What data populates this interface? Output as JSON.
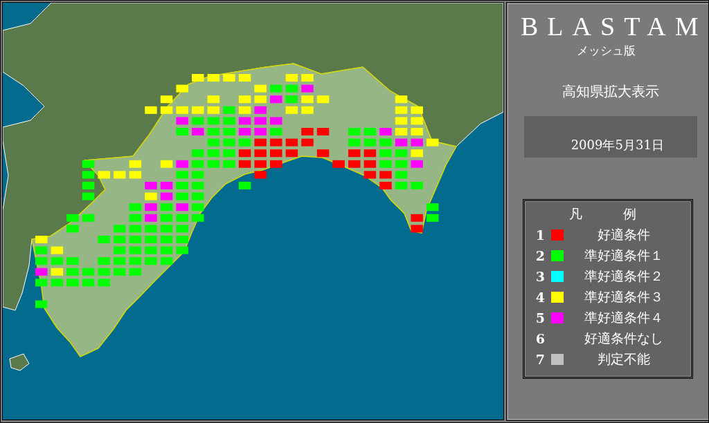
{
  "panel": {
    "title": "BLASTAM",
    "subtitle": "メッシュ版",
    "region": "高知県拡大表示",
    "date": "2009年5月31日"
  },
  "legend": {
    "title": "凡　例",
    "items": [
      {
        "number": "1",
        "color": "#ff0000",
        "label": "好適条件"
      },
      {
        "number": "2",
        "color": "#00ff00",
        "label": "準好適条件１"
      },
      {
        "number": "3",
        "color": "#00ffff",
        "label": "準好適条件２"
      },
      {
        "number": "4",
        "color": "#ffff00",
        "label": "準好適条件３"
      },
      {
        "number": "5",
        "color": "#ff00ff",
        "label": "準好適条件４"
      },
      {
        "number": "6",
        "label": "好適条件なし"
      },
      {
        "number": "7",
        "color": "#c0c0c0",
        "label": "判定不能"
      }
    ]
  },
  "mesh": [
    [
      {
        "kind": "gap"
      },
      {
        "kind": "gap"
      },
      {
        "kind": "gap"
      },
      {
        "kind": "gap"
      },
      {
        "kind": "gap"
      },
      {
        "kind": "gap"
      },
      {
        "kind": "gap"
      },
      {
        "kind": "gap"
      },
      {
        "kind": "gap"
      },
      {
        "kind": "gap"
      },
      {
        "kind": "cell",
        "color": "#ffff00"
      },
      {
        "kind": "cell",
        "color": "#ffff00"
      },
      {
        "kind": "cell",
        "color": "#ffff00"
      },
      {
        "kind": "cell",
        "color": "#ffff00"
      },
      {
        "kind": "gap"
      },
      {
        "kind": "gap"
      },
      {
        "kind": "cell",
        "color": "#ffff00"
      },
      {
        "kind": "cell",
        "color": "#ffff00"
      }
    ],
    [
      {
        "kind": "gap"
      },
      {
        "kind": "gap"
      },
      {
        "kind": "gap"
      },
      {
        "kind": "gap"
      },
      {
        "kind": "gap"
      },
      {
        "kind": "gap"
      },
      {
        "kind": "gap"
      },
      {
        "kind": "gap"
      },
      {
        "kind": "gap"
      },
      {
        "kind": "cell",
        "color": "#ffff00"
      },
      {
        "kind": "gap"
      },
      {
        "kind": "gap"
      },
      {
        "kind": "gap"
      },
      {
        "kind": "gap"
      },
      {
        "kind": "cell",
        "color": "#ffff00"
      },
      {
        "kind": "cell",
        "color": "#00ff00"
      },
      {
        "kind": "cell",
        "color": "#00ff00"
      },
      {
        "kind": "cell",
        "color": "#ff00ff"
      }
    ],
    [
      {
        "kind": "gap"
      },
      {
        "kind": "gap"
      },
      {
        "kind": "gap"
      },
      {
        "kind": "gap"
      },
      {
        "kind": "gap"
      },
      {
        "kind": "gap"
      },
      {
        "kind": "gap"
      },
      {
        "kind": "gap"
      },
      {
        "kind": "cell",
        "color": "#ffff00"
      },
      {
        "kind": "gap"
      },
      {
        "kind": "gap"
      },
      {
        "kind": "cell",
        "color": "#ffff00"
      },
      {
        "kind": "gap"
      },
      {
        "kind": "cell",
        "color": "#ffff00"
      },
      {
        "kind": "cell",
        "color": "#ffff00"
      },
      {
        "kind": "cell",
        "color": "#ff00ff"
      },
      {
        "kind": "cell",
        "color": "#00ff00"
      },
      {
        "kind": "cell",
        "color": "#ffff00"
      },
      {
        "kind": "cell",
        "color": "#ffff00"
      },
      {
        "kind": "gap"
      },
      {
        "kind": "gap"
      },
      {
        "kind": "gap"
      },
      {
        "kind": "gap"
      },
      {
        "kind": "cell",
        "color": "#ffff00"
      }
    ],
    [
      {
        "kind": "gap"
      },
      {
        "kind": "gap"
      },
      {
        "kind": "gap"
      },
      {
        "kind": "gap"
      },
      {
        "kind": "gap"
      },
      {
        "kind": "gap"
      },
      {
        "kind": "gap"
      },
      {
        "kind": "cell",
        "color": "#ffff00"
      },
      {
        "kind": "cell",
        "color": "#ffff00"
      },
      {
        "kind": "cell",
        "color": "#ffff00"
      },
      {
        "kind": "cell",
        "color": "#ffff00"
      },
      {
        "kind": "cell",
        "color": "#ffff00"
      },
      {
        "kind": "cell",
        "color": "#00ff00"
      },
      {
        "kind": "cell",
        "color": "#ffff00"
      },
      {
        "kind": "cell",
        "color": "#ff00ff"
      },
      {
        "kind": "gap"
      },
      {
        "kind": "cell",
        "color": "#ffff00"
      },
      {
        "kind": "cell",
        "color": "#ffff00"
      },
      {
        "kind": "gap"
      },
      {
        "kind": "gap"
      },
      {
        "kind": "gap"
      },
      {
        "kind": "gap"
      },
      {
        "kind": "gap"
      },
      {
        "kind": "cell",
        "color": "#ffff00"
      },
      {
        "kind": "cell",
        "color": "#ffff00"
      }
    ],
    [
      {
        "kind": "gap"
      },
      {
        "kind": "gap"
      },
      {
        "kind": "gap"
      },
      {
        "kind": "gap"
      },
      {
        "kind": "gap"
      },
      {
        "kind": "gap"
      },
      {
        "kind": "gap"
      },
      {
        "kind": "gap"
      },
      {
        "kind": "gap"
      },
      {
        "kind": "cell",
        "color": "#ff00ff"
      },
      {
        "kind": "cell",
        "color": "#00ff00"
      },
      {
        "kind": "cell",
        "color": "#00ff00"
      },
      {
        "kind": "cell",
        "color": "#00ff00"
      },
      {
        "kind": "cell",
        "color": "#ff00ff"
      },
      {
        "kind": "cell",
        "color": "#ff00ff"
      },
      {
        "kind": "cell",
        "color": "#ff00ff"
      },
      {
        "kind": "gap"
      },
      {
        "kind": "gap"
      },
      {
        "kind": "gap"
      },
      {
        "kind": "gap"
      },
      {
        "kind": "gap"
      },
      {
        "kind": "gap"
      },
      {
        "kind": "gap"
      },
      {
        "kind": "cell",
        "color": "#ffff00"
      },
      {
        "kind": "cell",
        "color": "#ffff00"
      }
    ],
    [
      {
        "kind": "gap"
      },
      {
        "kind": "gap"
      },
      {
        "kind": "gap"
      },
      {
        "kind": "gap"
      },
      {
        "kind": "gap"
      },
      {
        "kind": "gap"
      },
      {
        "kind": "gap"
      },
      {
        "kind": "gap"
      },
      {
        "kind": "gap"
      },
      {
        "kind": "cell",
        "color": "#00ff00"
      },
      {
        "kind": "cell",
        "color": "#ff00ff"
      },
      {
        "kind": "cell",
        "color": "#00ff00"
      },
      {
        "kind": "cell",
        "color": "#00ff00"
      },
      {
        "kind": "cell",
        "color": "#ff00ff"
      },
      {
        "kind": "cell",
        "color": "#ff00ff"
      },
      {
        "kind": "cell",
        "color": "#00ff00"
      },
      {
        "kind": "gap"
      },
      {
        "kind": "cell",
        "color": "#ff0000"
      },
      {
        "kind": "cell",
        "color": "#ff0000"
      },
      {
        "kind": "gap"
      },
      {
        "kind": "cell",
        "color": "#00ff00"
      },
      {
        "kind": "cell",
        "color": "#00ff00"
      },
      {
        "kind": "cell",
        "color": "#ff00ff"
      },
      {
        "kind": "cell",
        "color": "#ffff00"
      },
      {
        "kind": "cell",
        "color": "#ffff00"
      }
    ],
    [
      {
        "kind": "gap"
      },
      {
        "kind": "gap"
      },
      {
        "kind": "gap"
      },
      {
        "kind": "gap"
      },
      {
        "kind": "gap"
      },
      {
        "kind": "gap"
      },
      {
        "kind": "gap"
      },
      {
        "kind": "gap"
      },
      {
        "kind": "gap"
      },
      {
        "kind": "gap"
      },
      {
        "kind": "gap"
      },
      {
        "kind": "cell",
        "color": "#00ff00"
      },
      {
        "kind": "cell",
        "color": "#00ff00"
      },
      {
        "kind": "cell",
        "color": "#00ff00"
      },
      {
        "kind": "cell",
        "color": "#ff0000"
      },
      {
        "kind": "cell",
        "color": "#ff0000"
      },
      {
        "kind": "cell",
        "color": "#ff0000"
      },
      {
        "kind": "cell",
        "color": "#ff0000"
      },
      {
        "kind": "gap"
      },
      {
        "kind": "gap"
      },
      {
        "kind": "cell",
        "color": "#00ff00"
      },
      {
        "kind": "cell",
        "color": "#00ff00"
      },
      {
        "kind": "cell",
        "color": "#00ff00"
      },
      {
        "kind": "cell",
        "color": "#ff00ff"
      },
      {
        "kind": "cell",
        "color": "#ff00ff"
      },
      {
        "kind": "cell",
        "color": "#ffff00"
      }
    ],
    [
      {
        "kind": "gap"
      },
      {
        "kind": "gap"
      },
      {
        "kind": "gap"
      },
      {
        "kind": "gap"
      },
      {
        "kind": "gap"
      },
      {
        "kind": "gap"
      },
      {
        "kind": "gap"
      },
      {
        "kind": "gap"
      },
      {
        "kind": "gap"
      },
      {
        "kind": "gap"
      },
      {
        "kind": "cell",
        "color": "#00ff00"
      },
      {
        "kind": "cell",
        "color": "#00ff00"
      },
      {
        "kind": "cell",
        "color": "#00ff00"
      },
      {
        "kind": "cell",
        "color": "#ff0000"
      },
      {
        "kind": "cell",
        "color": "#ff0000"
      },
      {
        "kind": "cell",
        "color": "#ff0000"
      },
      {
        "kind": "cell",
        "color": "#ff0000"
      },
      {
        "kind": "gap"
      },
      {
        "kind": "cell",
        "color": "#ff0000"
      },
      {
        "kind": "gap"
      },
      {
        "kind": "cell",
        "color": "#ff0000"
      },
      {
        "kind": "cell",
        "color": "#ff0000"
      },
      {
        "kind": "cell",
        "color": "#00ff00"
      },
      {
        "kind": "cell",
        "color": "#00ff00"
      },
      {
        "kind": "cell",
        "color": "#ffff00"
      }
    ],
    [
      {
        "kind": "gap"
      },
      {
        "kind": "gap"
      },
      {
        "kind": "gap"
      },
      {
        "kind": "cell",
        "color": "#00ff00"
      },
      {
        "kind": "gap"
      },
      {
        "kind": "gap"
      },
      {
        "kind": "cell",
        "color": "#ffff00"
      },
      {
        "kind": "gap"
      },
      {
        "kind": "cell",
        "color": "#ffff00"
      },
      {
        "kind": "cell",
        "color": "#ff00ff"
      },
      {
        "kind": "cell",
        "color": "#00ff00"
      },
      {
        "kind": "cell",
        "color": "#00ff00"
      },
      {
        "kind": "cell",
        "color": "#00ff00"
      },
      {
        "kind": "cell",
        "color": "#ff0000"
      },
      {
        "kind": "cell",
        "color": "#ff0000"
      },
      {
        "kind": "cell",
        "color": "#ff0000"
      },
      {
        "kind": "gap"
      },
      {
        "kind": "gap"
      },
      {
        "kind": "gap"
      },
      {
        "kind": "cell",
        "color": "#ff0000"
      },
      {
        "kind": "cell",
        "color": "#ff0000"
      },
      {
        "kind": "cell",
        "color": "#ff0000"
      },
      {
        "kind": "cell",
        "color": "#00ff00"
      },
      {
        "kind": "cell",
        "color": "#00ff00"
      },
      {
        "kind": "cell",
        "color": "#ff00ff"
      }
    ],
    [
      {
        "kind": "gap"
      },
      {
        "kind": "gap"
      },
      {
        "kind": "gap"
      },
      {
        "kind": "cell",
        "color": "#00ff00"
      },
      {
        "kind": "cell",
        "color": "#ffff00"
      },
      {
        "kind": "cell",
        "color": "#ffff00"
      },
      {
        "kind": "cell",
        "color": "#ffff00"
      },
      {
        "kind": "gap"
      },
      {
        "kind": "gap"
      },
      {
        "kind": "cell",
        "color": "#00ff00"
      },
      {
        "kind": "cell",
        "color": "#00ff00"
      },
      {
        "kind": "gap"
      },
      {
        "kind": "gap"
      },
      {
        "kind": "gap"
      },
      {
        "kind": "cell",
        "color": "#ff0000"
      },
      {
        "kind": "gap"
      },
      {
        "kind": "gap"
      },
      {
        "kind": "gap"
      },
      {
        "kind": "gap"
      },
      {
        "kind": "gap"
      },
      {
        "kind": "gap"
      },
      {
        "kind": "cell",
        "color": "#ff0000"
      },
      {
        "kind": "cell",
        "color": "#ff0000"
      },
      {
        "kind": "cell",
        "color": "#00ff00"
      }
    ],
    [
      {
        "kind": "gap"
      },
      {
        "kind": "gap"
      },
      {
        "kind": "gap"
      },
      {
        "kind": "cell",
        "color": "#00ff00"
      },
      {
        "kind": "gap"
      },
      {
        "kind": "gap"
      },
      {
        "kind": "gap"
      },
      {
        "kind": "cell",
        "color": "#ff00ff"
      },
      {
        "kind": "cell",
        "color": "#ff00ff"
      },
      {
        "kind": "cell",
        "color": "#00ff00"
      },
      {
        "kind": "cell",
        "color": "#00ff00"
      },
      {
        "kind": "gap"
      },
      {
        "kind": "gap"
      },
      {
        "kind": "cell",
        "color": "#00ff00"
      },
      {
        "kind": "gap"
      },
      {
        "kind": "gap"
      },
      {
        "kind": "gap"
      },
      {
        "kind": "gap"
      },
      {
        "kind": "gap"
      },
      {
        "kind": "gap"
      },
      {
        "kind": "gap"
      },
      {
        "kind": "gap"
      },
      {
        "kind": "cell",
        "color": "#ff0000"
      },
      {
        "kind": "cell",
        "color": "#00ff00"
      },
      {
        "kind": "cell",
        "color": "#00ff00"
      }
    ],
    [
      {
        "kind": "gap"
      },
      {
        "kind": "gap"
      },
      {
        "kind": "gap"
      },
      {
        "kind": "cell",
        "color": "#00ff00"
      },
      {
        "kind": "gap"
      },
      {
        "kind": "gap"
      },
      {
        "kind": "gap"
      },
      {
        "kind": "cell",
        "color": "#ffff00"
      },
      {
        "kind": "cell",
        "color": "#ff00ff"
      },
      {
        "kind": "cell",
        "color": "#00ff00"
      },
      {
        "kind": "cell",
        "color": "#00ff00"
      }
    ],
    [
      {
        "kind": "gap"
      },
      {
        "kind": "gap"
      },
      {
        "kind": "gap"
      },
      {
        "kind": "gap"
      },
      {
        "kind": "gap"
      },
      {
        "kind": "gap"
      },
      {
        "kind": "cell",
        "color": "#00ff00"
      },
      {
        "kind": "cell",
        "color": "#ff00ff"
      },
      {
        "kind": "cell",
        "color": "#00ff00"
      },
      {
        "kind": "cell",
        "color": "#ff00ff"
      },
      {
        "kind": "cell",
        "color": "#00ff00"
      },
      {
        "kind": "gap"
      },
      {
        "kind": "gap"
      },
      {
        "kind": "gap"
      },
      {
        "kind": "gap"
      },
      {
        "kind": "gap"
      },
      {
        "kind": "gap"
      },
      {
        "kind": "gap"
      },
      {
        "kind": "gap"
      },
      {
        "kind": "gap"
      },
      {
        "kind": "gap"
      },
      {
        "kind": "gap"
      },
      {
        "kind": "gap"
      },
      {
        "kind": "gap"
      },
      {
        "kind": "gap"
      },
      {
        "kind": "cell",
        "color": "#00ff00"
      }
    ],
    [
      {
        "kind": "gap"
      },
      {
        "kind": "gap"
      },
      {
        "kind": "cell",
        "color": "#00ff00"
      },
      {
        "kind": "cell",
        "color": "#00ff00"
      },
      {
        "kind": "gap"
      },
      {
        "kind": "gap"
      },
      {
        "kind": "cell",
        "color": "#00ff00"
      },
      {
        "kind": "cell",
        "color": "#ff00ff"
      },
      {
        "kind": "cell",
        "color": "#00ff00"
      },
      {
        "kind": "cell",
        "color": "#00ff00"
      },
      {
        "kind": "cell",
        "color": "#00ff00"
      },
      {
        "kind": "gap"
      },
      {
        "kind": "gap"
      },
      {
        "kind": "gap"
      },
      {
        "kind": "gap"
      },
      {
        "kind": "gap"
      },
      {
        "kind": "gap"
      },
      {
        "kind": "gap"
      },
      {
        "kind": "gap"
      },
      {
        "kind": "gap"
      },
      {
        "kind": "gap"
      },
      {
        "kind": "gap"
      },
      {
        "kind": "gap"
      },
      {
        "kind": "gap"
      },
      {
        "kind": "cell",
        "color": "#ff0000"
      },
      {
        "kind": "cell",
        "color": "#00ff00"
      }
    ],
    [
      {
        "kind": "gap"
      },
      {
        "kind": "gap"
      },
      {
        "kind": "cell",
        "color": "#00ff00"
      },
      {
        "kind": "gap"
      },
      {
        "kind": "gap"
      },
      {
        "kind": "cell",
        "color": "#00ff00"
      },
      {
        "kind": "cell",
        "color": "#00ff00"
      },
      {
        "kind": "cell",
        "color": "#00ff00"
      },
      {
        "kind": "cell",
        "color": "#00ff00"
      },
      {
        "kind": "cell",
        "color": "#00ff00"
      },
      {
        "kind": "gap"
      },
      {
        "kind": "gap"
      },
      {
        "kind": "gap"
      },
      {
        "kind": "gap"
      },
      {
        "kind": "gap"
      },
      {
        "kind": "gap"
      },
      {
        "kind": "gap"
      },
      {
        "kind": "gap"
      },
      {
        "kind": "gap"
      },
      {
        "kind": "gap"
      },
      {
        "kind": "gap"
      },
      {
        "kind": "gap"
      },
      {
        "kind": "gap"
      },
      {
        "kind": "gap"
      },
      {
        "kind": "cell",
        "color": "#ff0000"
      }
    ],
    [
      {
        "kind": "cell",
        "color": "#ffff00"
      },
      {
        "kind": "gap"
      },
      {
        "kind": "gap"
      },
      {
        "kind": "gap"
      },
      {
        "kind": "cell",
        "color": "#00ff00"
      },
      {
        "kind": "cell",
        "color": "#00ff00"
      },
      {
        "kind": "cell",
        "color": "#00ff00"
      },
      {
        "kind": "cell",
        "color": "#00ff00"
      },
      {
        "kind": "cell",
        "color": "#00ff00"
      },
      {
        "kind": "cell",
        "color": "#00ff00"
      }
    ],
    [
      {
        "kind": "cell",
        "color": "#00ff00"
      },
      {
        "kind": "cell",
        "color": "#ffff00"
      },
      {
        "kind": "gap"
      },
      {
        "kind": "gap"
      },
      {
        "kind": "gap"
      },
      {
        "kind": "cell",
        "color": "#00ff00"
      },
      {
        "kind": "cell",
        "color": "#00ff00"
      },
      {
        "kind": "cell",
        "color": "#00ff00"
      },
      {
        "kind": "cell",
        "color": "#00ff00"
      },
      {
        "kind": "cell",
        "color": "#00ff00"
      }
    ],
    [
      {
        "kind": "cell",
        "color": "#00ff00"
      },
      {
        "kind": "cell",
        "color": "#00ff00"
      },
      {
        "kind": "cell",
        "color": "#00ff00"
      },
      {
        "kind": "gap"
      },
      {
        "kind": "cell",
        "color": "#00ff00"
      },
      {
        "kind": "cell",
        "color": "#00ff00"
      },
      {
        "kind": "cell",
        "color": "#00ff00"
      },
      {
        "kind": "cell",
        "color": "#00ff00"
      },
      {
        "kind": "cell",
        "color": "#00ff00"
      }
    ],
    [
      {
        "kind": "cell",
        "color": "#ff00ff"
      },
      {
        "kind": "cell",
        "color": "#ffff00"
      },
      {
        "kind": "cell",
        "color": "#00ff00"
      },
      {
        "kind": "cell",
        "color": "#00ff00"
      },
      {
        "kind": "cell",
        "color": "#00ff00"
      },
      {
        "kind": "cell",
        "color": "#00ff00"
      },
      {
        "kind": "cell",
        "color": "#00ff00"
      }
    ],
    [
      {
        "kind": "cell",
        "color": "#00ff00"
      },
      {
        "kind": "cell",
        "color": "#00ff00"
      },
      {
        "kind": "cell",
        "color": "#00ff00"
      },
      {
        "kind": "cell",
        "color": "#00ff00"
      },
      {
        "kind": "cell",
        "color": "#00ff00"
      }
    ],
    [
      {
        "kind": "gap"
      }
    ],
    [
      {
        "kind": "cell",
        "color": "#00ff00"
      }
    ]
  ]
}
